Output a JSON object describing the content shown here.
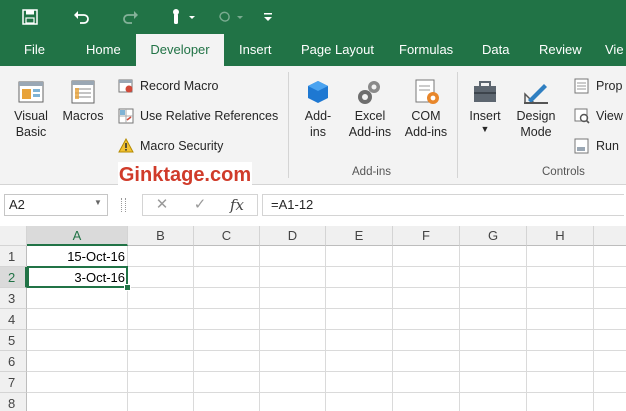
{
  "quick_access": {
    "save_icon": "save-icon",
    "undo_icon": "undo-icon",
    "redo_icon": "redo-icon",
    "touch_icon": "touch-mode-icon",
    "customize_icon": "customize-qat-icon"
  },
  "tabs": [
    {
      "label": "File"
    },
    {
      "label": "Home"
    },
    {
      "label": "Developer"
    },
    {
      "label": "Insert"
    },
    {
      "label": "Page Layout"
    },
    {
      "label": "Formulas"
    },
    {
      "label": "Data"
    },
    {
      "label": "Review"
    },
    {
      "label": "Vie"
    }
  ],
  "ribbon": {
    "code": {
      "visual_basic": "Visual\nBasic",
      "macros": "Macros",
      "record_macro": "Record Macro",
      "use_relative_references": "Use Relative References",
      "macro_security": "Macro Security"
    },
    "addins": {
      "addins": "Add-\nins",
      "excel_addins": "Excel\nAdd-ins",
      "com_addins": "COM\nAdd-ins",
      "group_label": "Add-ins"
    },
    "controls": {
      "insert": "Insert",
      "design_mode": "Design\nMode",
      "properties": "Prop",
      "view_code": "View",
      "run_dialog": "Run",
      "group_label": "Controls"
    }
  },
  "watermark": "Ginktage.com",
  "formula_bar": {
    "name_box": "A2",
    "formula": "=A1-12",
    "fx_label": "fx"
  },
  "sheet": {
    "columns": [
      "A",
      "B",
      "C",
      "D",
      "E",
      "F",
      "G",
      "H"
    ],
    "rows": [
      "1",
      "2",
      "3",
      "4",
      "5",
      "6",
      "7",
      "8"
    ],
    "cells": {
      "A1": "15-Oct-16",
      "A2": "3-Oct-16"
    },
    "selected_cell": "A2"
  },
  "colors": {
    "accent": "#217346",
    "watermark": "#d03b2a"
  }
}
